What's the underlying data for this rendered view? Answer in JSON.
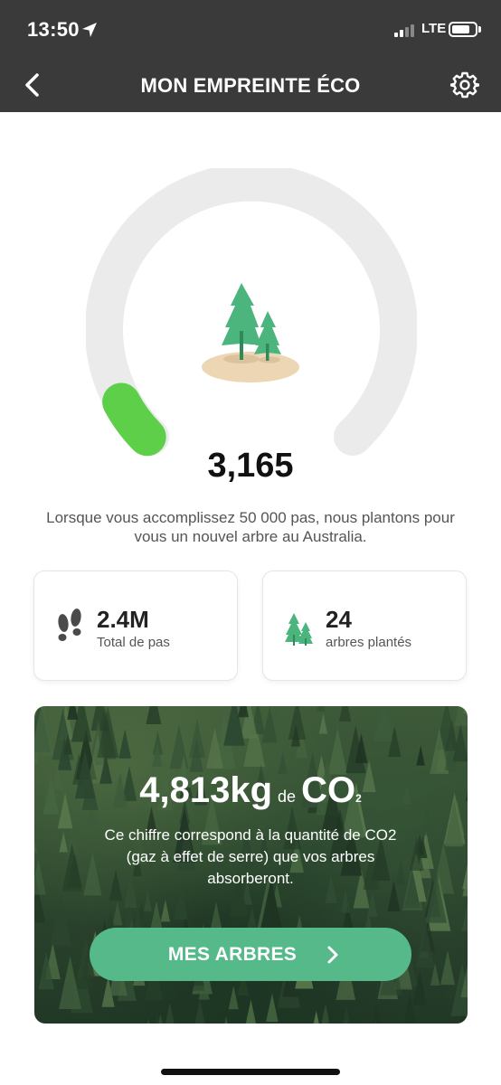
{
  "status_bar": {
    "time": "13:50",
    "network": "LTE"
  },
  "nav": {
    "title": "MON EMPREINTE ÉCO"
  },
  "progress": {
    "steps": "3,165",
    "goal_steps": 50000,
    "fraction": 0.063
  },
  "description": "Lorsque vous accomplissez 50 000 pas, nous plantons pour vous un nouvel arbre au Australia.",
  "stats": {
    "total_steps": {
      "value": "2.4M",
      "label": "Total de pas"
    },
    "trees_planted": {
      "value": "24",
      "label": "arbres plantés"
    }
  },
  "co2": {
    "amount": "4,813kg",
    "connector": "de",
    "unit": "CO",
    "subscript": "2",
    "description": "Ce chiffre correspond à la quantité de CO2 (gaz à effet de serre) que vos arbres absorberont."
  },
  "button": {
    "label": "MES ARBRES"
  },
  "colors": {
    "header_bg": "#3a3a3a",
    "accent_green": "#56b98a",
    "progress_green": "#5dcf48",
    "ring_track": "#ebebeb",
    "tree_green": "#4cb57e",
    "ground_sand": "#edd6b3"
  },
  "icons": [
    "location-arrow-icon",
    "signal-icon",
    "battery-icon",
    "back-icon",
    "settings-icon",
    "tree-illustration",
    "footprints-icon",
    "trees-icon",
    "chevron-right-icon"
  ]
}
